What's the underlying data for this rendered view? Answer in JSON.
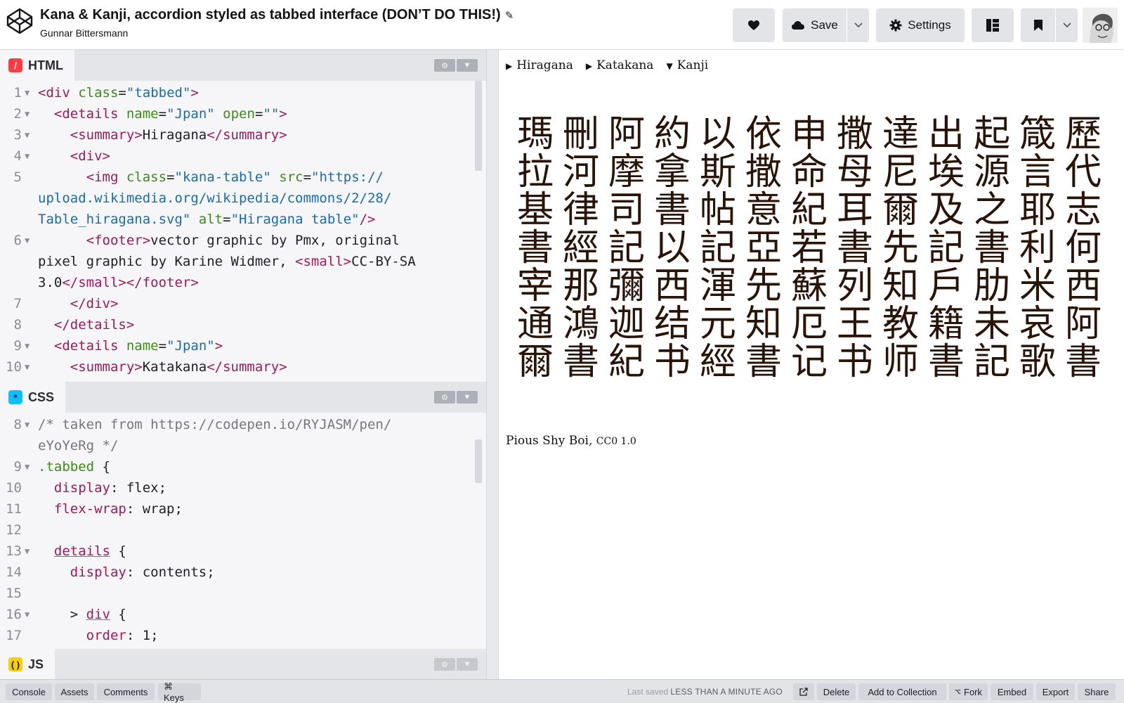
{
  "header": {
    "title": "Kana & Kanji, accordion styled as tabbed interface (DON’T DO THIS!)",
    "edit_icon": "pencil-icon",
    "author": "Gunnar Bittersmann",
    "buttons": {
      "save_label": "Save",
      "settings_label": "Settings"
    }
  },
  "editors": {
    "html": {
      "label": "HTML",
      "badge_color": "#ff3c41"
    },
    "css": {
      "label": "CSS",
      "badge_color": "#0ebeff"
    },
    "js": {
      "label": "JS",
      "badge_color": "#fcd000"
    }
  },
  "preview": {
    "tabs": [
      {
        "arrow": "▶",
        "label": "Hiragana"
      },
      {
        "arrow": "▶",
        "label": "Katakana"
      },
      {
        "arrow": "▼",
        "label": "Kanji"
      }
    ],
    "kanji_rows": [
      [
        "瑪",
        "刪",
        "阿",
        "約",
        "以",
        "依",
        "申",
        "撒",
        "達",
        "出",
        "起",
        "箴",
        "歷"
      ],
      [
        "拉",
        "河",
        "摩",
        "拿",
        "斯",
        "撒",
        "命",
        "母",
        "尼",
        "埃",
        "源",
        "言",
        "代"
      ],
      [
        "基",
        "律",
        "司",
        "書",
        "帖",
        "意",
        "紀",
        "耳",
        "爾",
        "及",
        "之",
        "耶",
        "志"
      ],
      [
        "書",
        "經",
        "記",
        "以",
        "記",
        "亞",
        "若",
        "書",
        "先",
        "記",
        "書",
        "利",
        "何"
      ],
      [
        "宰",
        "那",
        "彌",
        "西",
        "渾",
        "先",
        "蘇",
        "列",
        "知",
        "戶",
        "肋",
        "米",
        "西"
      ],
      [
        "通",
        "鴻",
        "迦",
        "结",
        "元",
        "知",
        "厄",
        "王",
        "教",
        "籍",
        "未",
        "哀",
        "阿"
      ],
      [
        "爾",
        "書",
        "紀",
        "书",
        "經",
        "書",
        "记",
        "书",
        "师",
        "書",
        "記",
        "歌",
        "書"
      ]
    ],
    "credit_name": "Pious Shy Boi,",
    "credit_license": "CC0 1.0"
  },
  "footer": {
    "console": "Console",
    "assets": "Assets",
    "comments": "Comments",
    "keys": "⌘ Keys",
    "last_saved_label": "Last saved",
    "last_saved_value": "LESS THAN A MINUTE AGO",
    "delete": "Delete",
    "add_to_collection": "Add to Collection",
    "fork": "Fork",
    "embed": "Embed",
    "export": "Export",
    "share": "Share"
  }
}
